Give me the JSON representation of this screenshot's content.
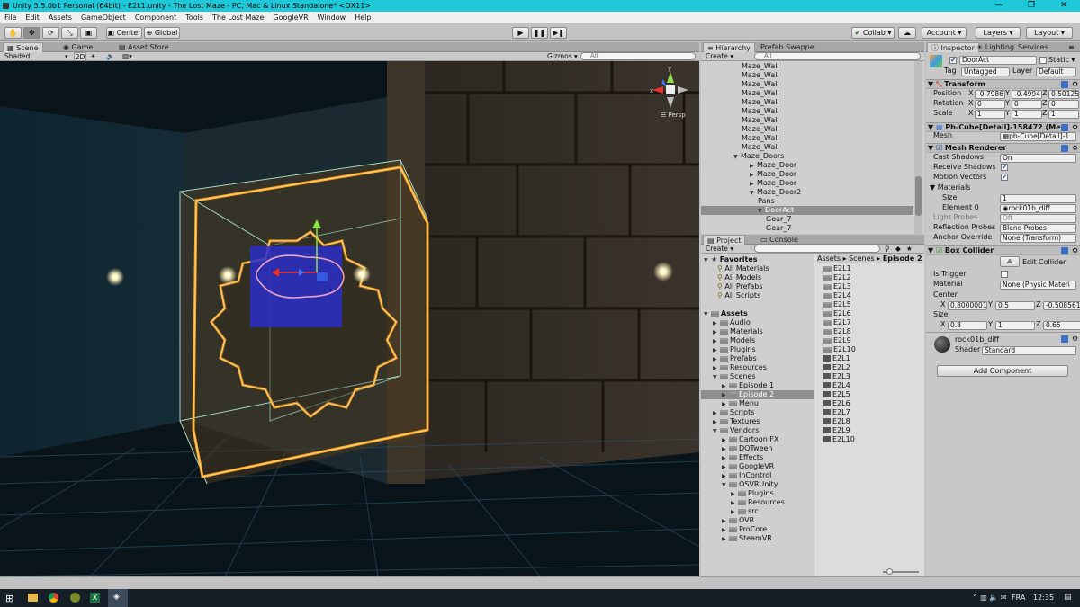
{
  "window": {
    "title": "Unity 5.5.0b1 Personal (64bit) - E2L1.unity - The Lost Maze - PC, Mac & Linux Standalone* <DX11>",
    "controls": [
      "—",
      "❐",
      "✕"
    ]
  },
  "menu": [
    "File",
    "Edit",
    "Assets",
    "GameObject",
    "Component",
    "Tools",
    "The Lost Maze",
    "GoogleVR",
    "Window",
    "Help"
  ],
  "toolbar": {
    "tools": [
      "✋",
      "✥",
      "⟳",
      "⤡",
      "▣"
    ],
    "pivot": "Center",
    "space": "Global",
    "play": "▶",
    "pause": "❚❚",
    "step": "▶❚",
    "collab": "Collab ▾",
    "account": "Account ▾",
    "layers": "Layers ▾",
    "layout": "Layout ▾"
  },
  "scene": {
    "tabs": [
      "Scene",
      "Game",
      "Asset Store"
    ],
    "shading": "Shaded",
    "mode2d": "2D",
    "gizmos": "Gizmos ▾",
    "search_placeholder": "All",
    "persp": "Persp",
    "axes": {
      "y": "y",
      "x": "x"
    }
  },
  "hierarchy": {
    "tabs": [
      "Hierarchy",
      "Prefab Swappe"
    ],
    "create": "Create ▾",
    "search_placeholder": "All",
    "items": [
      {
        "label": "Maze_Wall",
        "indent": 0
      },
      {
        "label": "Maze_Wall",
        "indent": 0
      },
      {
        "label": "Maze_Wall",
        "indent": 0
      },
      {
        "label": "Maze_Wall",
        "indent": 0
      },
      {
        "label": "Maze_Wall",
        "indent": 0
      },
      {
        "label": "Maze_Wall",
        "indent": 0
      },
      {
        "label": "Maze_Wall",
        "indent": 0
      },
      {
        "label": "Maze_Wall",
        "indent": 0
      },
      {
        "label": "Maze_Wall",
        "indent": 0
      },
      {
        "label": "Maze_Wall",
        "indent": 0
      },
      {
        "label": "Maze_Doors",
        "indent": -1,
        "arrow": "▼"
      },
      {
        "label": "Maze_Door",
        "indent": 1,
        "arrow": "▶"
      },
      {
        "label": "Maze_Door",
        "indent": 1,
        "arrow": "▶"
      },
      {
        "label": "Maze_Door",
        "indent": 1,
        "arrow": "▶"
      },
      {
        "label": "Maze_Door2",
        "indent": 1,
        "arrow": "▼"
      },
      {
        "label": "Pans",
        "indent": 2
      },
      {
        "label": "DoorAct",
        "indent": 2,
        "arrow": "▼",
        "selected": true
      },
      {
        "label": "Gear_7",
        "indent": 3
      },
      {
        "label": "Gear_7",
        "indent": 3
      }
    ]
  },
  "project": {
    "tabs": [
      "Project",
      "Console"
    ],
    "create": "Create ▾",
    "breadcrumb": [
      "Assets",
      "Scenes",
      "Episode 2"
    ],
    "favorites_label": "Favorites",
    "favorites": [
      "All Materials",
      "All Models",
      "All Prefabs",
      "All Scripts"
    ],
    "assets_label": "Assets",
    "tree": [
      {
        "label": "Audio",
        "indent": 1
      },
      {
        "label": "Materials",
        "indent": 1
      },
      {
        "label": "Models",
        "indent": 1
      },
      {
        "label": "Plugins",
        "indent": 1
      },
      {
        "label": "Prefabs",
        "indent": 1
      },
      {
        "label": "Resources",
        "indent": 1
      },
      {
        "label": "Scenes",
        "indent": 1,
        "open": true
      },
      {
        "label": "Episode 1",
        "indent": 2
      },
      {
        "label": "Episode 2",
        "indent": 2,
        "selected": true
      },
      {
        "label": "Menu",
        "indent": 2
      },
      {
        "label": "Scripts",
        "indent": 1
      },
      {
        "label": "Textures",
        "indent": 1
      },
      {
        "label": "Vendors",
        "indent": 1,
        "open": true
      },
      {
        "label": "Cartoon FX",
        "indent": 2
      },
      {
        "label": "DOTween",
        "indent": 2
      },
      {
        "label": "Effects",
        "indent": 2
      },
      {
        "label": "GoogleVR",
        "indent": 2
      },
      {
        "label": "InControl",
        "indent": 2
      },
      {
        "label": "OSVRUnity",
        "indent": 2,
        "open": true
      },
      {
        "label": "Plugins",
        "indent": 3
      },
      {
        "label": "Resources",
        "indent": 3
      },
      {
        "label": "src",
        "indent": 3
      },
      {
        "label": "OVR",
        "indent": 2
      },
      {
        "label": "ProCore",
        "indent": 2
      },
      {
        "label": "SteamVR",
        "indent": 2
      }
    ],
    "files": [
      {
        "label": "E2L1",
        "kind": "folder"
      },
      {
        "label": "E2L2",
        "kind": "folder"
      },
      {
        "label": "E2L3",
        "kind": "folder"
      },
      {
        "label": "E2L4",
        "kind": "folder"
      },
      {
        "label": "E2L5",
        "kind": "folder"
      },
      {
        "label": "E2L6",
        "kind": "folder"
      },
      {
        "label": "E2L7",
        "kind": "folder"
      },
      {
        "label": "E2L8",
        "kind": "folder"
      },
      {
        "label": "E2L9",
        "kind": "folder"
      },
      {
        "label": "E2L10",
        "kind": "folder"
      },
      {
        "label": "E2L1",
        "kind": "scene"
      },
      {
        "label": "E2L2",
        "kind": "scene"
      },
      {
        "label": "E2L3",
        "kind": "scene"
      },
      {
        "label": "E2L4",
        "kind": "scene"
      },
      {
        "label": "E2L5",
        "kind": "scene"
      },
      {
        "label": "E2L6",
        "kind": "scene"
      },
      {
        "label": "E2L7",
        "kind": "scene"
      },
      {
        "label": "E2L8",
        "kind": "scene"
      },
      {
        "label": "E2L9",
        "kind": "scene"
      },
      {
        "label": "E2L10",
        "kind": "scene"
      }
    ]
  },
  "inspector": {
    "tabs": [
      "Inspector",
      "Lighting",
      "Services"
    ],
    "object_name": "DoorAct",
    "static_label": "Static ▾",
    "tag_label": "Tag",
    "tag_value": "Untagged",
    "layer_label": "Layer",
    "layer_value": "Default",
    "transform": {
      "title": "Transform",
      "position_label": "Position",
      "rotation_label": "Rotation",
      "scale_label": "Scale",
      "position": [
        "-0.7986",
        "-0.4994",
        "0.50125"
      ],
      "rotation": [
        "0",
        "0",
        "0"
      ],
      "scale": [
        "1",
        "1",
        "1"
      ]
    },
    "mesh_filter": {
      "title": "Pb-Cube[Detail]-158472 (Me",
      "mesh_label": "Mesh",
      "mesh_value": "pb-Cube[Detail]-1"
    },
    "mesh_renderer": {
      "title": "Mesh Renderer",
      "cast_shadows_label": "Cast Shadows",
      "cast_shadows_value": "On",
      "receive_shadows_label": "Receive Shadows",
      "motion_vectors_label": "Motion Vectors",
      "materials_label": "Materials",
      "size_label": "Size",
      "size_value": "1",
      "element0_label": "Element 0",
      "element0_value": "rock01b_diff",
      "light_probes_label": "Light Probes",
      "light_probes_value": "Off",
      "reflection_probes_label": "Reflection Probes",
      "reflection_probes_value": "Blend Probes",
      "anchor_label": "Anchor Override",
      "anchor_value": "None (Transform)"
    },
    "box_collider": {
      "title": "Box Collider",
      "edit_label": "Edit Collider",
      "trigger_label": "Is Trigger",
      "material_label": "Material",
      "material_value": "None (Physic Materi",
      "center_label": "Center",
      "center": [
        "0.8000001",
        "0.5",
        "-0.5085616"
      ],
      "size_label": "Size",
      "size": [
        "0.8",
        "1",
        "0.65"
      ]
    },
    "material": {
      "name": "rock01b_diff",
      "shader_label": "Shader",
      "shader_value": "Standard"
    },
    "add_component": "Add Component",
    "axis": [
      "X",
      "Y",
      "Z"
    ]
  },
  "taskbar": {
    "lang": "FRA",
    "time": "12:35"
  }
}
